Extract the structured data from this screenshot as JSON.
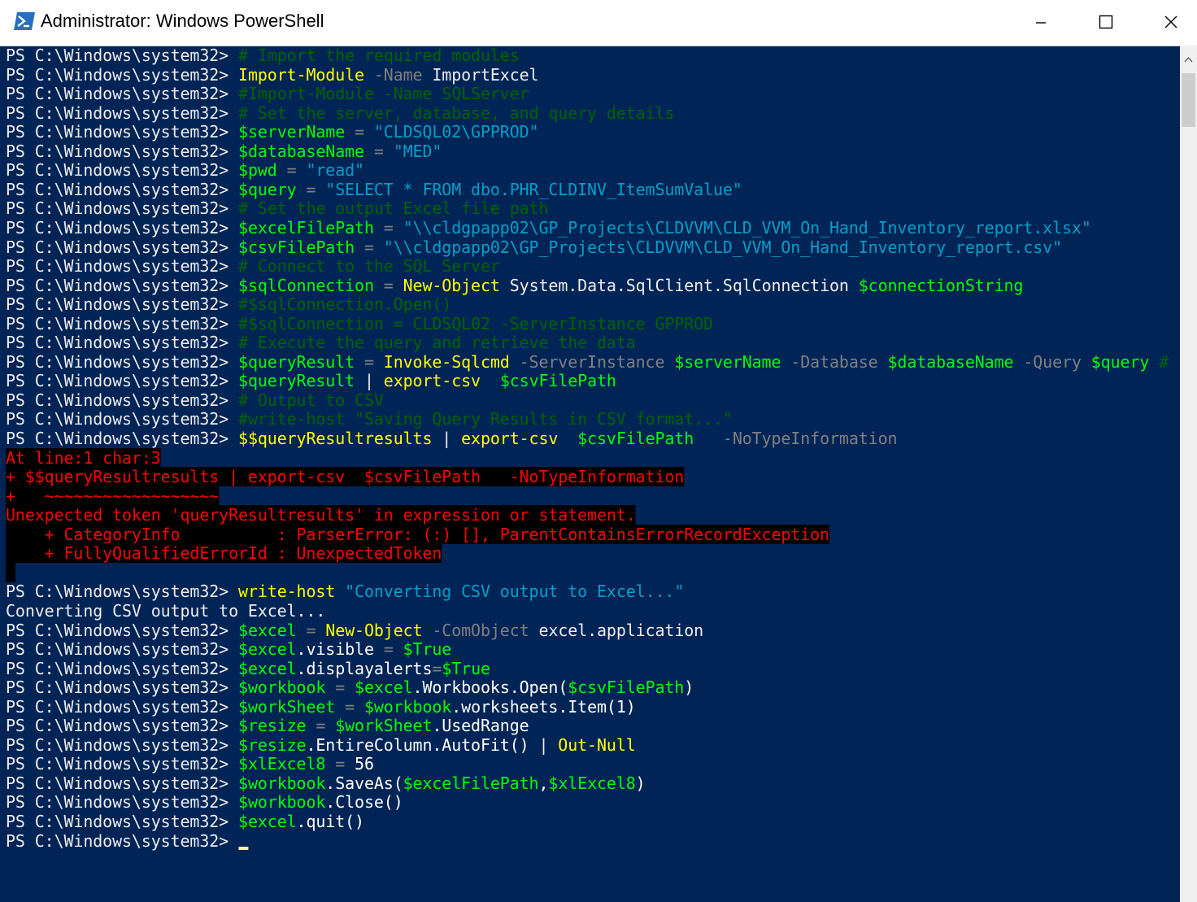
{
  "window": {
    "title": "Administrator: Windows PowerShell",
    "icon": "powershell-icon",
    "controls": [
      "minimize-icon",
      "maximize-icon",
      "close-icon"
    ]
  },
  "theme": {
    "background": "#012456",
    "default": "#eeedf0",
    "comment": "#006400",
    "command": "#ffff00",
    "parameter": "#808080",
    "variable": "#00ff00",
    "string": "#00a0c8",
    "error": "#ff0000"
  },
  "prompt": "PS C:\\Windows\\system32> ",
  "lines": [
    {
      "tokens": [
        {
          "t": "PS C:\\Windows\\system32> ",
          "c": "default"
        },
        {
          "t": "# Import the required modules",
          "c": "comment"
        }
      ]
    },
    {
      "tokens": [
        {
          "t": "PS C:\\Windows\\system32> ",
          "c": "default"
        },
        {
          "t": "Import-Module",
          "c": "command"
        },
        {
          "t": " -Name",
          "c": "parameter"
        },
        {
          "t": " ImportExcel",
          "c": "default"
        }
      ]
    },
    {
      "tokens": [
        {
          "t": "PS C:\\Windows\\system32> ",
          "c": "default"
        },
        {
          "t": "#Import-Module -Name SQLServer",
          "c": "comment"
        }
      ]
    },
    {
      "tokens": [
        {
          "t": "PS C:\\Windows\\system32> ",
          "c": "default"
        },
        {
          "t": "# Set the server, database, and query details",
          "c": "comment"
        }
      ]
    },
    {
      "tokens": [
        {
          "t": "PS C:\\Windows\\system32> ",
          "c": "default"
        },
        {
          "t": "$serverName",
          "c": "variable"
        },
        {
          "t": " = ",
          "c": "operator"
        },
        {
          "t": "\"CLDSQL02\\GPPROD\"",
          "c": "string"
        }
      ]
    },
    {
      "tokens": [
        {
          "t": "PS C:\\Windows\\system32> ",
          "c": "default"
        },
        {
          "t": "$databaseName",
          "c": "variable"
        },
        {
          "t": " = ",
          "c": "operator"
        },
        {
          "t": "\"MED\"",
          "c": "string"
        }
      ]
    },
    {
      "tokens": [
        {
          "t": "PS C:\\Windows\\system32> ",
          "c": "default"
        },
        {
          "t": "$pwd",
          "c": "variable"
        },
        {
          "t": " = ",
          "c": "operator"
        },
        {
          "t": "\"read\"",
          "c": "string"
        }
      ]
    },
    {
      "tokens": [
        {
          "t": "PS C:\\Windows\\system32> ",
          "c": "default"
        },
        {
          "t": "$query",
          "c": "variable"
        },
        {
          "t": " = ",
          "c": "operator"
        },
        {
          "t": "\"SELECT * FROM dbo.PHR_CLDINV_ItemSumValue\"",
          "c": "string"
        }
      ]
    },
    {
      "tokens": [
        {
          "t": "PS C:\\Windows\\system32> ",
          "c": "default"
        },
        {
          "t": "# Set the output Excel file path",
          "c": "comment"
        }
      ]
    },
    {
      "tokens": [
        {
          "t": "PS C:\\Windows\\system32> ",
          "c": "default"
        },
        {
          "t": "$excelFilePath",
          "c": "variable"
        },
        {
          "t": " = ",
          "c": "operator"
        },
        {
          "t": "\"\\\\cldgpapp02\\GP_Projects\\CLDVVM\\CLD_VVM_On_Hand_Inventory_report.xlsx\"",
          "c": "string"
        }
      ]
    },
    {
      "tokens": [
        {
          "t": "PS C:\\Windows\\system32> ",
          "c": "default"
        },
        {
          "t": "$csvFilePath",
          "c": "variable"
        },
        {
          "t": " = ",
          "c": "operator"
        },
        {
          "t": "\"\\\\cldgpapp02\\GP_Projects\\CLDVVM\\CLD_VVM_On_Hand_Inventory_report.csv\"",
          "c": "string"
        }
      ]
    },
    {
      "tokens": [
        {
          "t": "PS C:\\Windows\\system32> ",
          "c": "default"
        },
        {
          "t": "# Connect to the SQL Server",
          "c": "comment"
        }
      ]
    },
    {
      "tokens": [
        {
          "t": "PS C:\\Windows\\system32> ",
          "c": "default"
        },
        {
          "t": "$sqlConnection",
          "c": "variable"
        },
        {
          "t": " = ",
          "c": "operator"
        },
        {
          "t": "New-Object",
          "c": "command"
        },
        {
          "t": " System.Data.SqlClient.SqlConnection ",
          "c": "default"
        },
        {
          "t": "$connectionString",
          "c": "variable"
        }
      ]
    },
    {
      "tokens": [
        {
          "t": "PS C:\\Windows\\system32> ",
          "c": "default"
        },
        {
          "t": "#$sqlConnection.Open()",
          "c": "comment"
        }
      ]
    },
    {
      "tokens": [
        {
          "t": "PS C:\\Windows\\system32> ",
          "c": "default"
        },
        {
          "t": "#$sqlConnection = CLDSQL02 -ServerInstance GPPROD",
          "c": "comment"
        }
      ]
    },
    {
      "tokens": [
        {
          "t": "PS C:\\Windows\\system32> ",
          "c": "default"
        },
        {
          "t": "# Execute the query and retrieve the data",
          "c": "comment"
        }
      ]
    },
    {
      "tokens": [
        {
          "t": "PS C:\\Windows\\system32> ",
          "c": "default"
        },
        {
          "t": "$queryResult",
          "c": "variable"
        },
        {
          "t": " = ",
          "c": "operator"
        },
        {
          "t": "Invoke-Sqlcmd",
          "c": "command"
        },
        {
          "t": " -ServerInstance ",
          "c": "parameter"
        },
        {
          "t": "$serverName",
          "c": "variable"
        },
        {
          "t": " -Database ",
          "c": "parameter"
        },
        {
          "t": "$databaseName",
          "c": "variable"
        },
        {
          "t": " -Query ",
          "c": "parameter"
        },
        {
          "t": "$query",
          "c": "variable"
        },
        {
          "t": " #",
          "c": "comment"
        }
      ]
    },
    {
      "tokens": [
        {
          "t": "PS C:\\Windows\\system32> ",
          "c": "default"
        },
        {
          "t": "$queryResult",
          "c": "variable"
        },
        {
          "t": " | ",
          "c": "default"
        },
        {
          "t": "export-csv",
          "c": "command"
        },
        {
          "t": "  ",
          "c": "default"
        },
        {
          "t": "$csvFilePath",
          "c": "variable"
        }
      ]
    },
    {
      "tokens": [
        {
          "t": "PS C:\\Windows\\system32> ",
          "c": "default"
        },
        {
          "t": "# Output to CSV",
          "c": "comment"
        }
      ]
    },
    {
      "tokens": [
        {
          "t": "PS C:\\Windows\\system32> ",
          "c": "default"
        },
        {
          "t": "#write-host \"Saving Query Results in CSV format...\"",
          "c": "comment"
        }
      ]
    },
    {
      "tokens": [
        {
          "t": "PS C:\\Windows\\system32> ",
          "c": "default"
        },
        {
          "t": "$$queryResultresults",
          "c": "command"
        },
        {
          "t": " | ",
          "c": "default"
        },
        {
          "t": "export-csv",
          "c": "command"
        },
        {
          "t": "  ",
          "c": "default"
        },
        {
          "t": "$csvFilePath",
          "c": "variable"
        },
        {
          "t": "   -NoTypeInformation",
          "c": "parameter"
        }
      ]
    },
    {
      "tokens": [
        {
          "t": "At line:1 char:3",
          "c": "error"
        }
      ]
    },
    {
      "tokens": [
        {
          "t": "+ $$queryResultresults | export-csv  $csvFilePath   -NoTypeInformation",
          "c": "error"
        }
      ]
    },
    {
      "tokens": [
        {
          "t": "+   ~~~~~~~~~~~~~~~~~~",
          "c": "error"
        }
      ]
    },
    {
      "tokens": [
        {
          "t": "Unexpected token 'queryResultresults' in expression or statement.",
          "c": "error"
        }
      ]
    },
    {
      "tokens": [
        {
          "t": "    + CategoryInfo          : ParserError: (:) [], ParentContainsErrorRecordException",
          "c": "error"
        }
      ]
    },
    {
      "tokens": [
        {
          "t": "    + FullyQualifiedErrorId : UnexpectedToken",
          "c": "error"
        }
      ]
    },
    {
      "tokens": [
        {
          "t": " ",
          "c": "error"
        }
      ]
    },
    {
      "tokens": [
        {
          "t": "PS C:\\Windows\\system32> ",
          "c": "default"
        },
        {
          "t": "write-host",
          "c": "command"
        },
        {
          "t": " ",
          "c": "default"
        },
        {
          "t": "\"Converting CSV output to Excel...\"",
          "c": "string"
        }
      ]
    },
    {
      "tokens": [
        {
          "t": "Converting CSV output to Excel...",
          "c": "default"
        }
      ]
    },
    {
      "tokens": [
        {
          "t": "PS C:\\Windows\\system32> ",
          "c": "default"
        },
        {
          "t": "$excel",
          "c": "variable"
        },
        {
          "t": " = ",
          "c": "operator"
        },
        {
          "t": "New-Object",
          "c": "command"
        },
        {
          "t": " -ComObject",
          "c": "parameter"
        },
        {
          "t": " excel.application",
          "c": "default"
        }
      ]
    },
    {
      "tokens": [
        {
          "t": "PS C:\\Windows\\system32> ",
          "c": "default"
        },
        {
          "t": "$excel",
          "c": "variable"
        },
        {
          "t": ".visible",
          "c": "member"
        },
        {
          "t": " = ",
          "c": "operator"
        },
        {
          "t": "$True",
          "c": "variable"
        }
      ]
    },
    {
      "tokens": [
        {
          "t": "PS C:\\Windows\\system32> ",
          "c": "default"
        },
        {
          "t": "$excel",
          "c": "variable"
        },
        {
          "t": ".displayalerts",
          "c": "member"
        },
        {
          "t": "=",
          "c": "operator"
        },
        {
          "t": "$True",
          "c": "variable"
        }
      ]
    },
    {
      "tokens": [
        {
          "t": "PS C:\\Windows\\system32> ",
          "c": "default"
        },
        {
          "t": "$workbook",
          "c": "variable"
        },
        {
          "t": " = ",
          "c": "operator"
        },
        {
          "t": "$excel",
          "c": "variable"
        },
        {
          "t": ".Workbooks.Open(",
          "c": "member"
        },
        {
          "t": "$csvFilePath",
          "c": "variable"
        },
        {
          "t": ")",
          "c": "member"
        }
      ]
    },
    {
      "tokens": [
        {
          "t": "PS C:\\Windows\\system32> ",
          "c": "default"
        },
        {
          "t": "$workSheet",
          "c": "variable"
        },
        {
          "t": " = ",
          "c": "operator"
        },
        {
          "t": "$workbook",
          "c": "variable"
        },
        {
          "t": ".worksheets.Item(1)",
          "c": "member"
        }
      ]
    },
    {
      "tokens": [
        {
          "t": "PS C:\\Windows\\system32> ",
          "c": "default"
        },
        {
          "t": "$resize",
          "c": "variable"
        },
        {
          "t": " = ",
          "c": "operator"
        },
        {
          "t": "$workSheet",
          "c": "variable"
        },
        {
          "t": ".UsedRange",
          "c": "member"
        }
      ]
    },
    {
      "tokens": [
        {
          "t": "PS C:\\Windows\\system32> ",
          "c": "default"
        },
        {
          "t": "$resize",
          "c": "variable"
        },
        {
          "t": ".EntireColumn.AutoFit()",
          "c": "member"
        },
        {
          "t": " | ",
          "c": "default"
        },
        {
          "t": "Out-Null",
          "c": "command"
        }
      ]
    },
    {
      "tokens": [
        {
          "t": "PS C:\\Windows\\system32> ",
          "c": "default"
        },
        {
          "t": "$xlExcel8",
          "c": "variable"
        },
        {
          "t": " = ",
          "c": "operator"
        },
        {
          "t": "56",
          "c": "number"
        }
      ]
    },
    {
      "tokens": [
        {
          "t": "PS C:\\Windows\\system32> ",
          "c": "default"
        },
        {
          "t": "$workbook",
          "c": "variable"
        },
        {
          "t": ".SaveAs(",
          "c": "member"
        },
        {
          "t": "$excelFilePath",
          "c": "variable"
        },
        {
          "t": ",",
          "c": "member"
        },
        {
          "t": "$xlExcel8",
          "c": "variable"
        },
        {
          "t": ")",
          "c": "member"
        }
      ]
    },
    {
      "tokens": [
        {
          "t": "PS C:\\Windows\\system32> ",
          "c": "default"
        },
        {
          "t": "$workbook",
          "c": "variable"
        },
        {
          "t": ".Close()",
          "c": "member"
        }
      ]
    },
    {
      "tokens": [
        {
          "t": "PS C:\\Windows\\system32> ",
          "c": "default"
        },
        {
          "t": "$excel",
          "c": "variable"
        },
        {
          "t": ".quit()",
          "c": "member"
        }
      ]
    },
    {
      "tokens": [
        {
          "t": "PS C:\\Windows\\system32> ",
          "c": "default"
        }
      ],
      "cursor": true
    }
  ]
}
